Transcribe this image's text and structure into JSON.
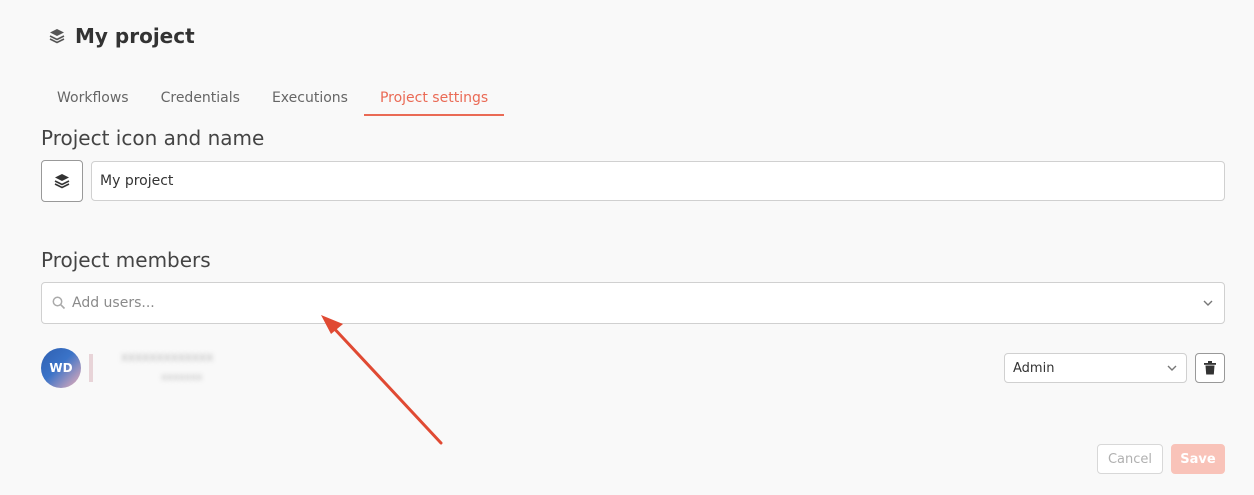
{
  "header": {
    "title": "My project",
    "icon": "layers-icon"
  },
  "tabs": [
    {
      "label": "Workflows",
      "active": false
    },
    {
      "label": "Credentials",
      "active": false
    },
    {
      "label": "Executions",
      "active": false
    },
    {
      "label": "Project settings",
      "active": true
    }
  ],
  "icon_section": {
    "title": "Project icon and name",
    "project_name_value": "My project"
  },
  "members_section": {
    "title": "Project members",
    "add_users_placeholder": "Add users...",
    "members": [
      {
        "initials": "WD",
        "role": "Admin"
      }
    ]
  },
  "footer": {
    "cancel_label": "Cancel",
    "save_label": "Save"
  },
  "colors": {
    "accent": "#ea6a55",
    "save_disabled": "#f9c3b9",
    "annotation_arrow": "#e04a33"
  }
}
